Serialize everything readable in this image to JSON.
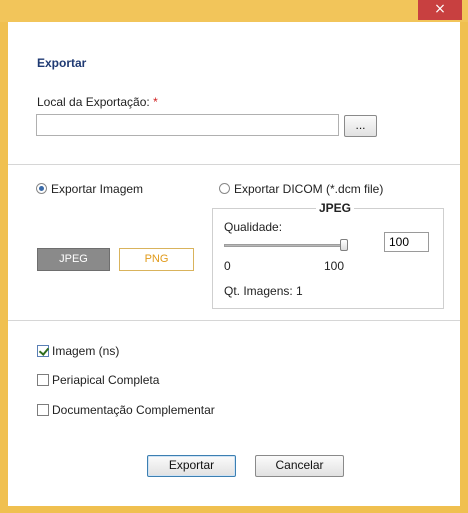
{
  "window": {
    "close_glyph": "×"
  },
  "export": {
    "title": "Exportar",
    "location_label": "Local da Exportação:",
    "required_mark": "*",
    "location_value": "",
    "browse_label": "..."
  },
  "type": {
    "image_option": {
      "label": "Exportar Imagem",
      "selected": true
    },
    "dicom_option": {
      "label": "Exportar DICOM (*.dcm file)",
      "selected": false
    }
  },
  "format": {
    "jpeg_label": "JPEG",
    "png_label": "PNG",
    "selected": "JPEG"
  },
  "jpeg_group": {
    "legend": "JPEG",
    "quality_label": "Qualidade:",
    "quality_value": "100",
    "slider_min": "0",
    "slider_max": "100",
    "slider_level": 1.0,
    "count_label": "Qt. Imagens:",
    "count_value": "1"
  },
  "options": [
    {
      "label": "Imagem (ns)",
      "checked": true
    },
    {
      "label": "Periapical Completa",
      "checked": false
    },
    {
      "label": "Documentação Complementar",
      "checked": false
    }
  ],
  "actions": {
    "export_label": "Exportar",
    "cancel_label": "Cancelar"
  },
  "colors": {
    "window_frame": "#f0c050",
    "title_accent": "#1f3a73",
    "required": "#d02020",
    "close_button": "#c84040",
    "png_text": "#e19a1a"
  }
}
